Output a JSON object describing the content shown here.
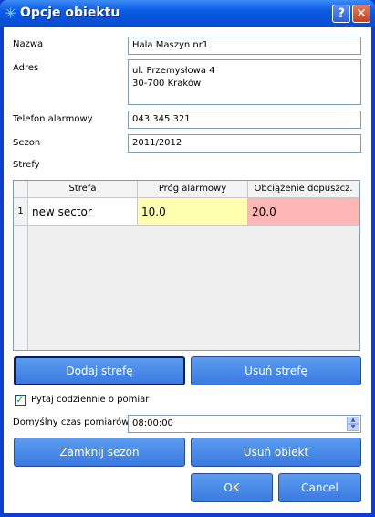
{
  "window": {
    "title": "Opcje obiektu",
    "help_label": "?",
    "close_label": "✕"
  },
  "form": {
    "name_label": "Nazwa",
    "name_value": "Hala Maszyn nr1",
    "address_label": "Adres",
    "address_line1": "ul. Przemysłowa 4",
    "address_line2": "30-700 Kraków",
    "phone_label": "Telefon alarmowy",
    "phone_value": "043 345 321",
    "season_label": "Sezon",
    "season_value": "2011/2012",
    "zones_label": "Strefy"
  },
  "grid": {
    "columns": [
      "Strefa",
      "Próg alarmowy",
      "Obciążenie dopuszcz."
    ],
    "rows": [
      {
        "num": "1",
        "strefa": "new sector",
        "prog": "10.0",
        "obciazenie": "20.0"
      }
    ],
    "colors": {
      "prog_bg": "#ffffb0",
      "obciazenie_bg": "#ffb6b6"
    }
  },
  "buttons": {
    "add_zone": "Dodaj strefę",
    "remove_zone": "Usuń strefę",
    "close_season": "Zamknij sezon",
    "remove_object": "Usuń obiekt",
    "ok": "OK",
    "cancel": "Cancel"
  },
  "options": {
    "ask_daily_label": "Pytaj codziennie o pomiar",
    "ask_daily_checked": true,
    "default_time_label": "Domyślny czas pomiarów",
    "default_time_value": "08:00:00"
  }
}
